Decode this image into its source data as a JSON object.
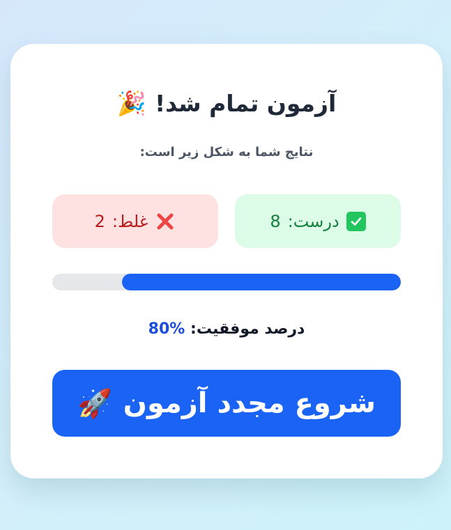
{
  "header": {
    "title": "آزمون تمام شد!",
    "title_icon": "party-popper-icon",
    "subtitle": "نتایج شما به شکل زیر است:"
  },
  "results": {
    "correct": {
      "label": "درست:",
      "count": "8",
      "icon": "check-mark-icon",
      "color": "#15803d"
    },
    "wrong": {
      "label": "غلط:",
      "count": "2",
      "icon": "cross-mark-icon",
      "color": "#b91c1c"
    }
  },
  "progress": {
    "fraction": 0.8,
    "fill_color": "#1a63f5"
  },
  "success": {
    "label": "درصد موفقیت:",
    "value": "%80"
  },
  "restart_button": {
    "label": "شروع مجدد آزمون",
    "icon": "rocket-icon"
  },
  "colors": {
    "accent": "#1a63f5",
    "correct_bg": "#dcfce7",
    "wrong_bg": "#fee2e2"
  }
}
